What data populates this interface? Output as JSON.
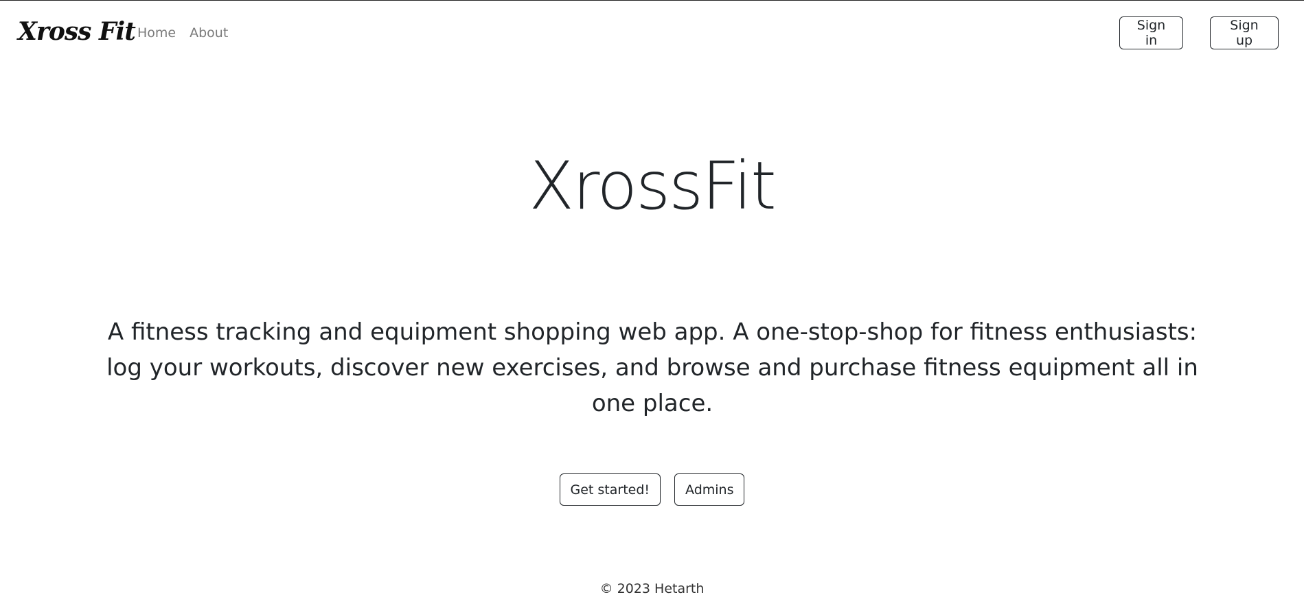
{
  "navbar": {
    "brand": "Xross Fit",
    "links": [
      "Home",
      "About"
    ],
    "sign_in": "Sign in",
    "sign_up": "Sign up"
  },
  "hero": {
    "title": "XrossFit",
    "description": "A fitness tracking and equipment shopping web app. A one-stop-shop for fitness enthusiasts: log your workouts, discover new exercises, and browse and purchase fitness equipment all in one place.",
    "buttons": [
      "Get started!",
      "Admins"
    ]
  },
  "footer": {
    "text": "© 2023 Hetarth"
  }
}
